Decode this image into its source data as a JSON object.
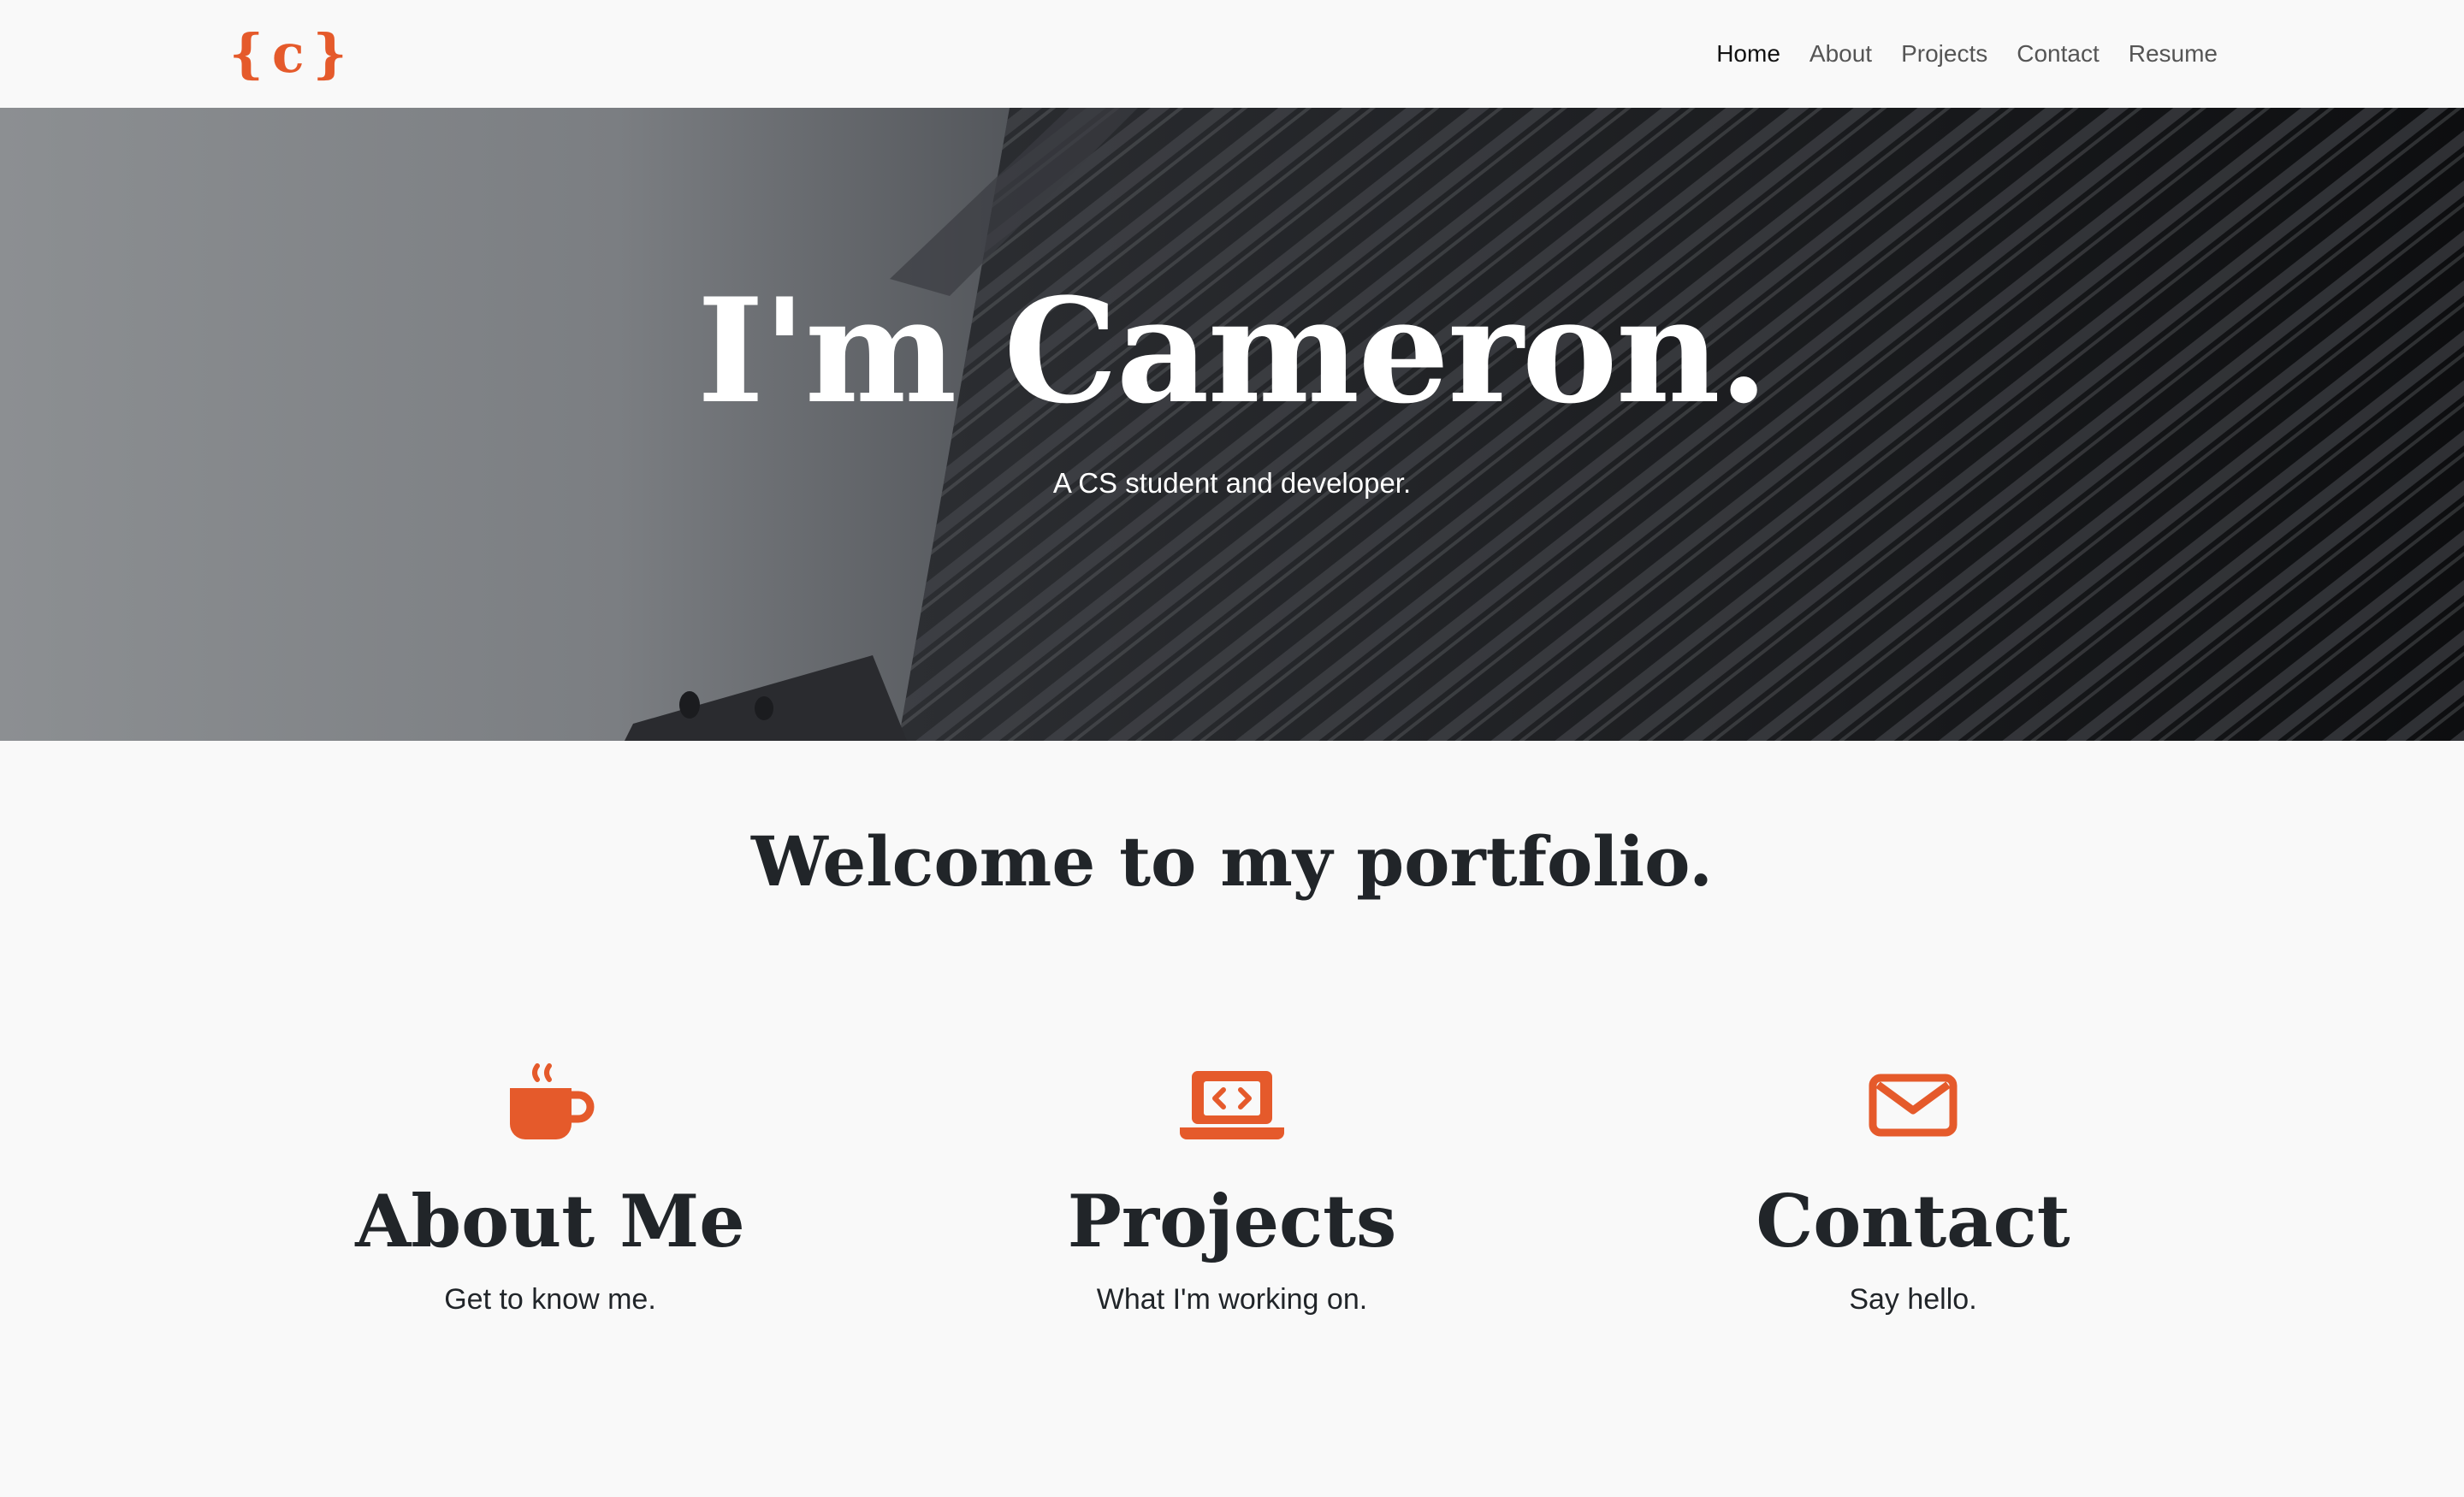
{
  "brand": {
    "logo_text": "{c}",
    "color": "#e55a2b"
  },
  "nav": {
    "items": [
      {
        "label": "Home",
        "active": true
      },
      {
        "label": "About",
        "active": false
      },
      {
        "label": "Projects",
        "active": false
      },
      {
        "label": "Contact",
        "active": false
      },
      {
        "label": "Resume",
        "active": false
      }
    ]
  },
  "hero": {
    "title": "I'm Cameron.",
    "subtitle": "A CS student and developer."
  },
  "welcome": {
    "heading": "Welcome to my portfolio."
  },
  "features": [
    {
      "icon": "coffee-mug-icon",
      "title": "About Me",
      "subtitle": "Get to know me."
    },
    {
      "icon": "laptop-code-icon",
      "title": "Projects",
      "subtitle": "What I'm working on."
    },
    {
      "icon": "envelope-icon",
      "title": "Contact",
      "subtitle": "Say hello."
    }
  ],
  "colors": {
    "accent": "#e55a2b",
    "text_dark": "#212529",
    "background": "#f9f9f9"
  }
}
